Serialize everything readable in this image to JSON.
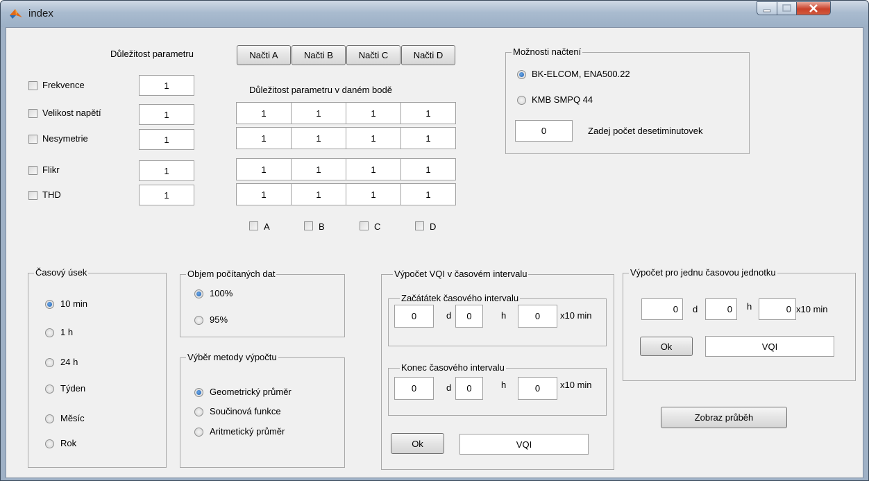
{
  "window": {
    "title": "index"
  },
  "importance": {
    "title": "Důležitost parametru",
    "point_title": "Důležitost parametru v daném bodě",
    "load_buttons": [
      "Načti A",
      "Načti B",
      "Načti C",
      "Načti D"
    ],
    "params": [
      {
        "label": "Frekvence",
        "weight": "1"
      },
      {
        "label": "Velikost napětí",
        "weight": "1"
      },
      {
        "label": "Nesymetrie",
        "weight": "1"
      },
      {
        "label": "Flikr",
        "weight": "1"
      },
      {
        "label": "THD",
        "weight": "1"
      }
    ],
    "grid": [
      [
        "1",
        "1",
        "1",
        "1"
      ],
      [
        "1",
        "1",
        "1",
        "1"
      ],
      [
        "1",
        "1",
        "1",
        "1"
      ],
      [
        "1",
        "1",
        "1",
        "1"
      ]
    ],
    "point_checks": [
      "A",
      "B",
      "C",
      "D"
    ]
  },
  "load_options": {
    "title": "Možnosti načtení",
    "options": [
      "BK-ELCOM, ENA500.22",
      "KMB SMPQ 44"
    ],
    "selected": 0,
    "count_value": "0",
    "count_label": "Zadej počet desetiminutovek"
  },
  "time_section": {
    "title": "Časový úsek",
    "options": [
      "10 min",
      "1 h",
      "24 h",
      "Týden",
      "Měsíc",
      "Rok"
    ],
    "selected": 0
  },
  "data_volume": {
    "title": "Objem počítaných dat",
    "options": [
      "100%",
      "95%"
    ],
    "selected": 0
  },
  "method": {
    "title": "Výběr metody výpočtu",
    "options": [
      "Geometrický průměr",
      "Součinová funkce",
      "Aritmetický průměr"
    ],
    "selected": 0
  },
  "vqi_interval": {
    "title": "Výpočet VQI v časovém intervalu",
    "start": {
      "title": "Začátátek časového intervalu",
      "d": "0",
      "h": "0",
      "m": "0"
    },
    "end": {
      "title": "Konec časového intervalu",
      "d": "0",
      "h": "0",
      "m": "0"
    },
    "unit_d": "d",
    "unit_h": "h",
    "unit_m": "x10 min",
    "ok": "Ok",
    "result": "VQI"
  },
  "vqi_single": {
    "title": "Výpočet pro jednu časovou jednotku",
    "d": "0",
    "h": "0",
    "m": "0",
    "unit_d": "d",
    "unit_h": "h",
    "unit_m": "x10 min",
    "ok": "Ok",
    "result": "VQI"
  },
  "show_button": "Zobraz průběh",
  "colors": {
    "client_bg": "#f0f0f0",
    "radio_dot": "#1f5fb0",
    "close_button": "#c9412a"
  }
}
